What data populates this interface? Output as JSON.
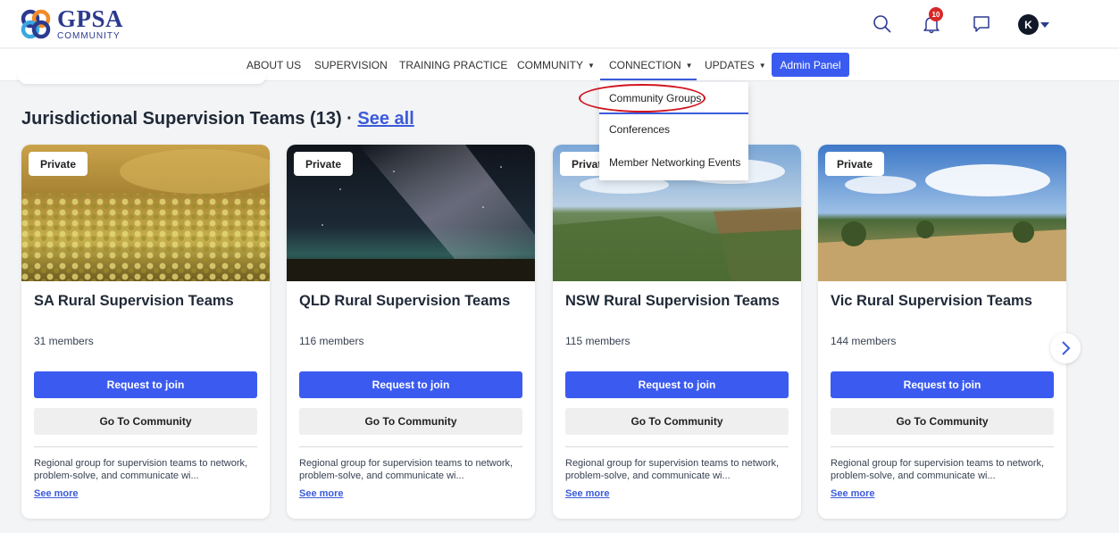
{
  "brand": {
    "name": "GPSA",
    "subtitle": "COMMUNITY"
  },
  "header": {
    "notifications_count": "10",
    "avatar_initial": "K",
    "icons": [
      "search-icon",
      "bell-icon",
      "chat-icon",
      "chevron-down-icon"
    ]
  },
  "nav": {
    "items": [
      {
        "label": "ABOUT US"
      },
      {
        "label": "SUPERVISION"
      },
      {
        "label": "TRAINING PRACTICE"
      },
      {
        "label": "COMMUNITY"
      },
      {
        "label": "CONNECTION"
      },
      {
        "label": "UPDATES"
      }
    ],
    "admin_label": "Admin Panel"
  },
  "dropdown": {
    "items": [
      {
        "label": "Community Groups"
      },
      {
        "label": "Conferences"
      },
      {
        "label": "Member Networking Events"
      }
    ]
  },
  "section": {
    "title": "Jurisdictional Supervision Teams (13) · ",
    "see_all": "See all"
  },
  "cards": [
    {
      "tag": "Private",
      "title": "SA Rural Supervision Teams",
      "members": "31 members",
      "join_label": "Request to join",
      "go_label": "Go To Community",
      "description": "Regional group for supervision teams to network, problem-solve, and communicate wi...",
      "see_more": "See more"
    },
    {
      "tag": "Private",
      "title": "QLD Rural Supervision Teams",
      "members": "116 members",
      "join_label": "Request to join",
      "go_label": "Go To Community",
      "description": "Regional group for supervision teams to network, problem-solve, and communicate wi...",
      "see_more": "See more"
    },
    {
      "tag": "Private",
      "title": "NSW Rural Supervision Teams",
      "members": "115 members",
      "join_label": "Request to join",
      "go_label": "Go To Community",
      "description": "Regional group for supervision teams to network, problem-solve, and communicate wi...",
      "see_more": "See more"
    },
    {
      "tag": "Private",
      "title": "Vic Rural Supervision Teams",
      "members": "144 members",
      "join_label": "Request to join",
      "go_label": "Go To Community",
      "description": "Regional group for supervision teams to network, problem-solve, and communicate wi...",
      "see_more": "See more"
    }
  ],
  "colors": {
    "accent": "#3b5bf0",
    "brand": "#2b3a8f",
    "badge": "#d62828",
    "highlight": "#d0141e"
  }
}
